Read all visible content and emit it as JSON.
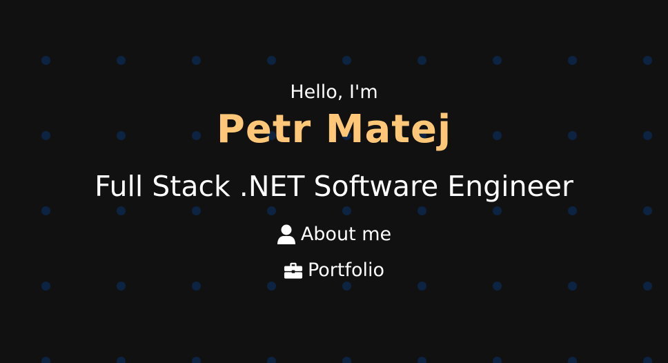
{
  "hero": {
    "greeting": "Hello, I'm",
    "name": "Petr Matej",
    "role": "Full Stack .NET Software Engineer"
  },
  "nav": {
    "about": {
      "label": "About me",
      "icon": "user-icon"
    },
    "portfolio": {
      "label": "Portfolio",
      "icon": "briefcase-icon"
    }
  },
  "colors": {
    "background": "#111111",
    "dots": "#0c2342",
    "accent": "#ffc777",
    "text": "#ffffff"
  }
}
